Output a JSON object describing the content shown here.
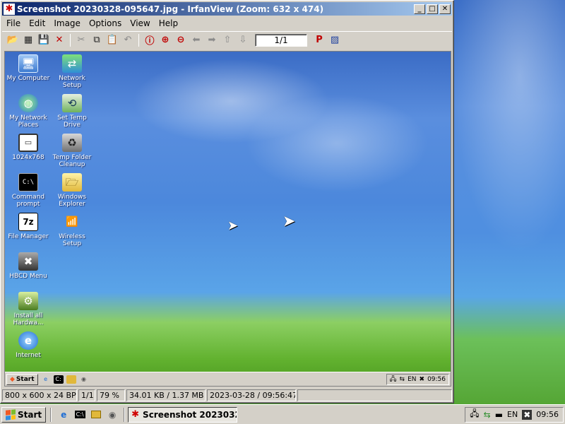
{
  "window": {
    "title": "Screenshot 20230328-095647.jpg - IrfanView (Zoom: 632 x 474)",
    "minimize": "_",
    "maximize": "□",
    "close": "✕"
  },
  "menu": [
    "File",
    "Edit",
    "Image",
    "Options",
    "View",
    "Help"
  ],
  "toolbar": {
    "page_value": "1/1"
  },
  "desktop_icons": [
    {
      "label": "My Computer",
      "icon": "computer-icon"
    },
    {
      "label": "Network Setup",
      "icon": "network-setup-icon"
    },
    {
      "label": "My Network Places",
      "icon": "network-places-icon"
    },
    {
      "label": "Set Temp Drive",
      "icon": "drive-icon"
    },
    {
      "label": "1024x768",
      "icon": "monitor-icon"
    },
    {
      "label": "Temp Folder Cleanup",
      "icon": "recycle-bin-icon"
    },
    {
      "label": "Command prompt",
      "icon": "command-prompt-icon"
    },
    {
      "label": "Windows Explorer",
      "icon": "folder-icon"
    },
    {
      "label": "File Manager",
      "icon": "7z-icon"
    },
    {
      "label": "Wireless Setup",
      "icon": "wireless-icon"
    },
    {
      "label": "HBCD Menu",
      "icon": "tools-icon"
    },
    {
      "label": "Install all Hardwa...",
      "icon": "install-icon"
    },
    {
      "label": "Internet",
      "icon": "ie-icon"
    }
  ],
  "inner_taskbar": {
    "start": "Start",
    "lang": "EN",
    "time": "09:56"
  },
  "status": {
    "dimensions": "800 x 600 x 24 BPP",
    "page": "1/1",
    "zoom": "79 %",
    "size": "34.01 KB / 1.37 MB",
    "datetime": "2023-03-28 / 09:56:47"
  },
  "taskbar": {
    "start": "Start",
    "task_label": "Screenshot 2023032...",
    "lang": "EN",
    "time": "09:56"
  }
}
